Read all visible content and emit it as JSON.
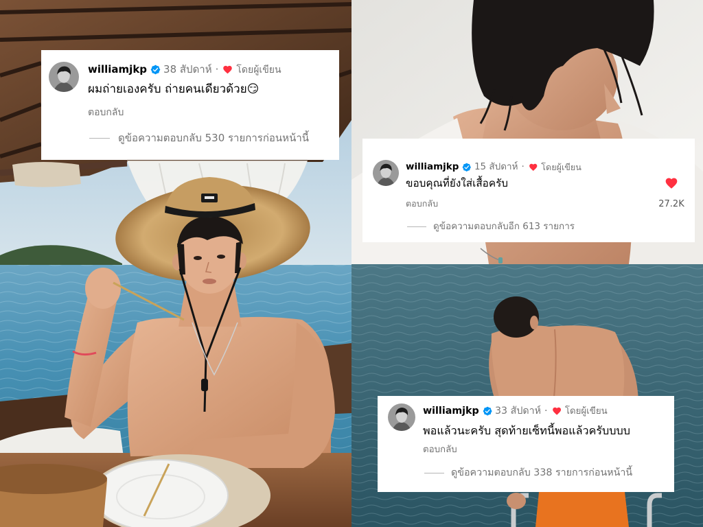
{
  "comments": [
    {
      "username": "williamjkp",
      "time": "38 สัปดาห์",
      "separator": "·",
      "author_label": "โดยผู้เขียน",
      "text": "ผมถ่ายเองครับ ถ่ายคนเดียวด้วย😏",
      "reply_label": "ตอบกลับ",
      "view_replies": "ดูข้อความตอบกลับ 530 รายการก่อนหน้านี้"
    },
    {
      "username": "williamjkp",
      "time": "15 สัปดาห์",
      "separator": "·",
      "author_label": "โดยผู้เขียน",
      "text": "ขอบคุณที่ยังใส่เสื้อครับ",
      "reply_label": "ตอบกลับ",
      "like_count": "27.2K",
      "view_replies": "ดูข้อความตอบกลับอีก 613 รายการ"
    },
    {
      "username": "williamjkp",
      "time": "33 สัปดาห์",
      "separator": "·",
      "author_label": "โดยผู้เขียน",
      "text": "พอแล้วนะครับ สุดท้ายเซ็ทนี้พอแล้วครับบบบ",
      "reply_label": "ตอบกลับ",
      "view_replies": "ดูข้อความตอบกลับ 338 รายการก่อนหน้านี้"
    }
  ],
  "icons": {
    "avatar": "avatar",
    "verified": "verified-badge-icon",
    "author_liked": "heart-icon",
    "like": "heart-icon"
  },
  "colors": {
    "card_bg": "#ffffff",
    "text": "#000000",
    "secondary_text": "#737373",
    "verified_blue": "#0095f6",
    "heart_red": "#ff3040",
    "divider": "#b5b5b5"
  }
}
